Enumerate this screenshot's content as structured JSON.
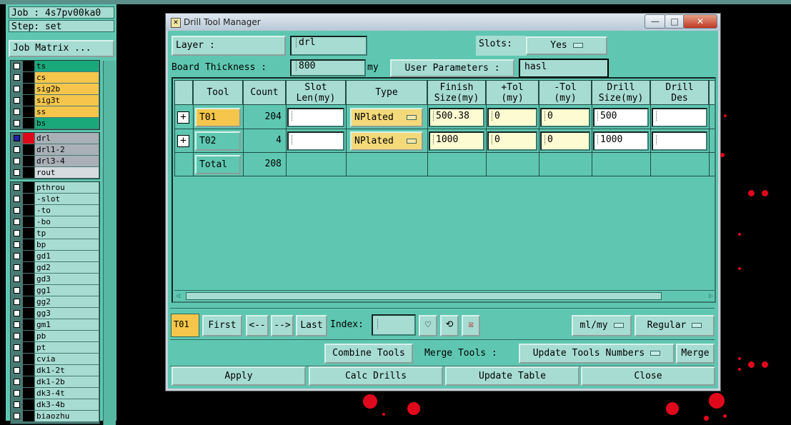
{
  "left_panel": {
    "job_label": "Job : 4s7pv00ka0",
    "step_label": "Step: set",
    "job_matrix_button": "Job Matrix ...",
    "groups": [
      [
        {
          "name": "ts",
          "color": "#1aa87a"
        },
        {
          "name": "cs",
          "color": "#f5c64b"
        },
        {
          "name": "sig2b",
          "color": "#f5c64b"
        },
        {
          "name": "sig3t",
          "color": "#f5c64b"
        },
        {
          "name": "ss",
          "color": "#f5c64b"
        },
        {
          "name": "bs",
          "color": "#1aa87a"
        }
      ],
      [
        {
          "name": "drl",
          "color": "#a9b0b8"
        },
        {
          "name": "drl1-2",
          "color": "#a9b0b8"
        },
        {
          "name": "drl3-4",
          "color": "#a9b0b8"
        },
        {
          "name": "rout",
          "color": "#d6dbe0"
        }
      ],
      [
        {
          "name": "pthrou",
          "color": "#a6dcd2"
        },
        {
          "name": "-slot",
          "color": "#a6dcd2"
        },
        {
          "name": "-to",
          "color": "#a6dcd2"
        },
        {
          "name": "-bo",
          "color": "#a6dcd2"
        },
        {
          "name": "tp",
          "color": "#a6dcd2"
        },
        {
          "name": "bp",
          "color": "#a6dcd2"
        },
        {
          "name": "gd1",
          "color": "#a6dcd2"
        },
        {
          "name": "gd2",
          "color": "#a6dcd2"
        },
        {
          "name": "gd3",
          "color": "#a6dcd2"
        },
        {
          "name": "gg1",
          "color": "#a6dcd2"
        },
        {
          "name": "gg2",
          "color": "#a6dcd2"
        },
        {
          "name": "gg3",
          "color": "#a6dcd2"
        },
        {
          "name": "gm1",
          "color": "#a6dcd2"
        },
        {
          "name": "pb",
          "color": "#a6dcd2"
        },
        {
          "name": "pt",
          "color": "#a6dcd2"
        },
        {
          "name": "cvia",
          "color": "#a6dcd2"
        },
        {
          "name": "dk1-2t",
          "color": "#a6dcd2"
        },
        {
          "name": "dk1-2b",
          "color": "#a6dcd2"
        },
        {
          "name": "dk3-4t",
          "color": "#a6dcd2"
        },
        {
          "name": "dk3-4b",
          "color": "#a6dcd2"
        },
        {
          "name": "biaozhu",
          "color": "#a6dcd2"
        }
      ]
    ]
  },
  "window": {
    "title": "Drill Tool Manager",
    "minimize": "—",
    "maximize": "□",
    "close": "✕"
  },
  "top": {
    "layer_label": "Layer        :",
    "layer_value": "drl",
    "slots_label": "Slots:",
    "slots_value": "Yes",
    "board_thickness_label": "Board Thickness :",
    "board_thickness_value": "800",
    "board_thickness_unit": "my",
    "user_params_button": "User Parameters :",
    "user_params_value": "hasl"
  },
  "table": {
    "headers": [
      "Tool",
      "Count",
      "Slot\nLen(my)",
      "Type",
      "Finish\nSize(my)",
      "+Tol\n(my)",
      "-Tol\n(my)",
      "Drill\nSize(my)",
      "Drill\nDes"
    ],
    "rows": [
      {
        "tool": "T01",
        "count": "204",
        "slot_len": "",
        "type": "NPlated",
        "finish": "500.38",
        "plus_tol": "0",
        "minus_tol": "0",
        "drill": "500",
        "drill_des": ""
      },
      {
        "tool": "T02",
        "count": "4",
        "slot_len": "",
        "type": "NPlated",
        "finish": "1000",
        "plus_tol": "0",
        "minus_tol": "0",
        "drill": "1000",
        "drill_des": ""
      }
    ],
    "total_label": "Total",
    "total_count": "208"
  },
  "nav": {
    "current_tool": "T01",
    "first": "First",
    "prev": "<--",
    "next": "-->",
    "last": "Last",
    "index_label": "Index:",
    "units": "ml/my",
    "mode": "Regular"
  },
  "actions": {
    "combine_tools": "Combine Tools",
    "merge_tools_label": "Merge Tools :",
    "merge_option": "Update Tools Numbers",
    "merge_button": "Merge",
    "apply": "Apply",
    "calc_drills": "Calc Drills",
    "update_table": "Update Table",
    "close": "Close"
  },
  "colors": {
    "panel_bg": "#5fc7b1",
    "field_bg": "#a6dcd2",
    "tool_highlight": "#f5c64b",
    "tol_bg": "#fdfbd2",
    "red_dots": "#e0091c"
  }
}
